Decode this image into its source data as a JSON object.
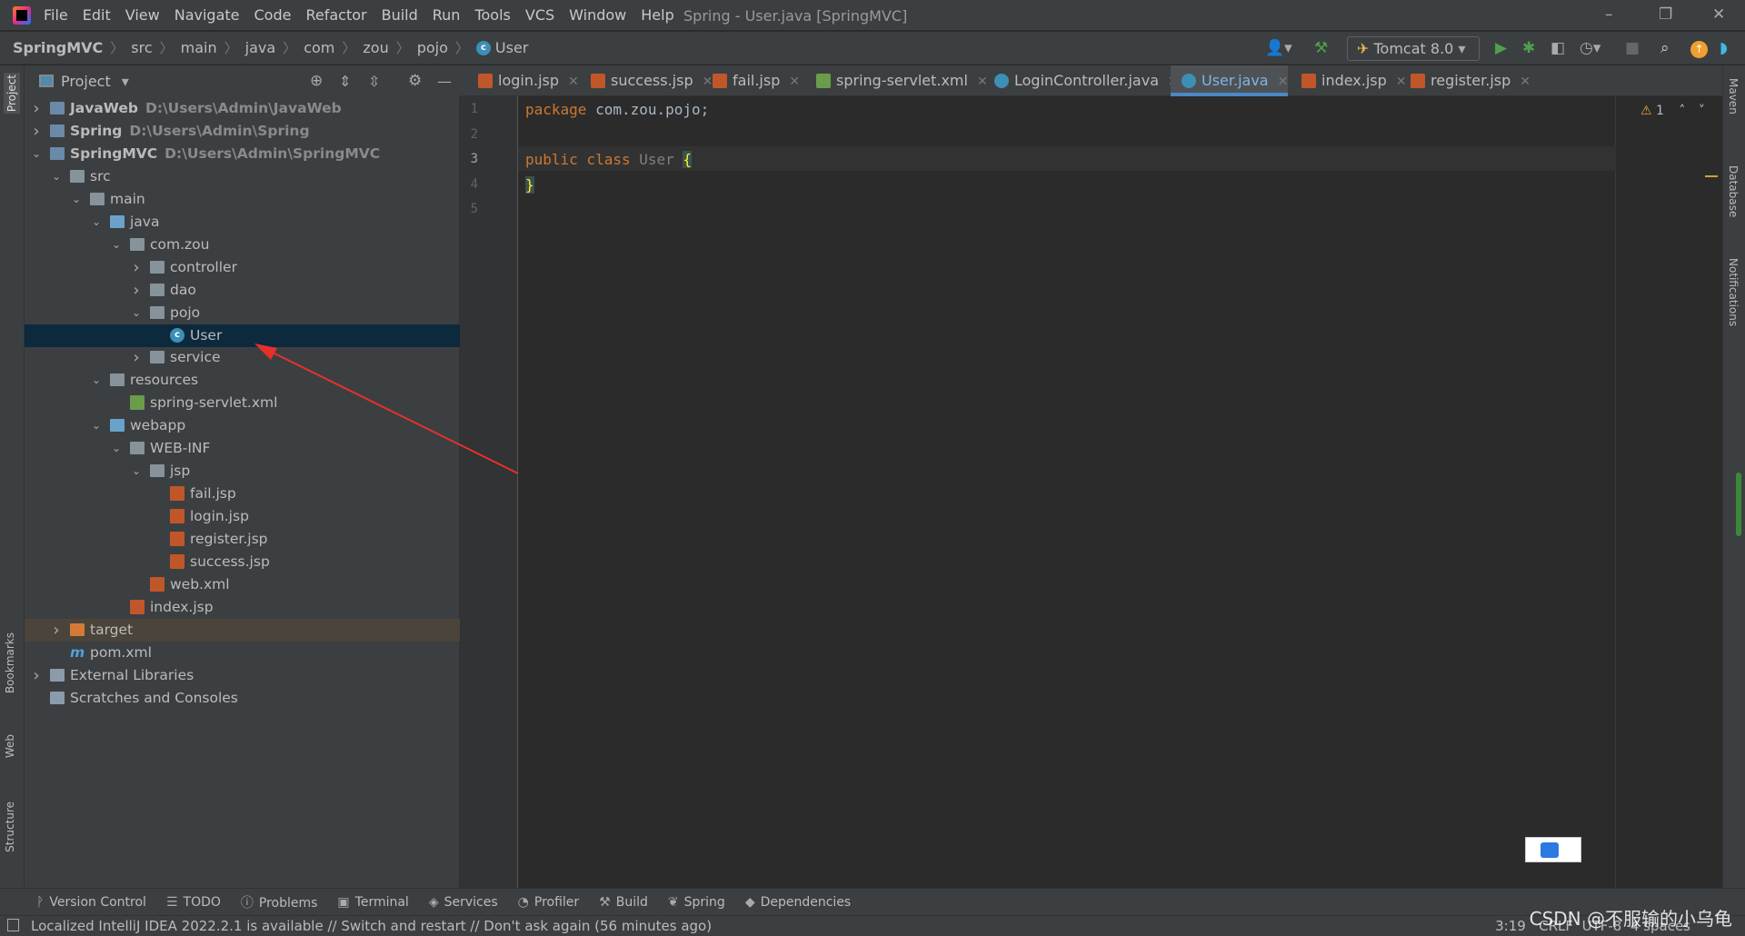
{
  "window": {
    "title": "Spring - User.java [SpringMVC]"
  },
  "menu": [
    "File",
    "Edit",
    "View",
    "Navigate",
    "Code",
    "Refactor",
    "Build",
    "Run",
    "Tools",
    "VCS",
    "Window",
    "Help"
  ],
  "breadcrumb": [
    "SpringMVC",
    "src",
    "main",
    "java",
    "com",
    "zou",
    "pojo",
    "User"
  ],
  "toolbar": {
    "run_config": "Tomcat 8.0"
  },
  "project_panel": {
    "title": "Project"
  },
  "tree": [
    {
      "label": "JavaWeb",
      "path": "D:\\Users\\Admin\\JavaWeb",
      "depth": 0,
      "chev": ">",
      "icon": "mod",
      "bold": true
    },
    {
      "label": "Spring",
      "path": "D:\\Users\\Admin\\Spring",
      "depth": 0,
      "chev": ">",
      "icon": "mod",
      "bold": true
    },
    {
      "label": "SpringMVC",
      "path": "D:\\Users\\Admin\\SpringMVC",
      "depth": 0,
      "chev": "v",
      "icon": "mod",
      "bold": true
    },
    {
      "label": "src",
      "depth": 1,
      "chev": "v",
      "icon": "folder"
    },
    {
      "label": "main",
      "depth": 2,
      "chev": "v",
      "icon": "folder"
    },
    {
      "label": "java",
      "depth": 3,
      "chev": "v",
      "icon": "folder blue"
    },
    {
      "label": "com.zou",
      "depth": 4,
      "chev": "v",
      "icon": "folder"
    },
    {
      "label": "controller",
      "depth": 5,
      "chev": ">",
      "icon": "folder"
    },
    {
      "label": "dao",
      "depth": 5,
      "chev": ">",
      "icon": "folder"
    },
    {
      "label": "pojo",
      "depth": 5,
      "chev": "v",
      "icon": "folder"
    },
    {
      "label": "User",
      "depth": 6,
      "chev": "",
      "icon": "class",
      "selected": true
    },
    {
      "label": "service",
      "depth": 5,
      "chev": ">",
      "icon": "folder"
    },
    {
      "label": "resources",
      "depth": 3,
      "chev": "v",
      "icon": "folder"
    },
    {
      "label": "spring-servlet.xml",
      "depth": 4,
      "chev": "",
      "icon": "xml"
    },
    {
      "label": "webapp",
      "depth": 3,
      "chev": "v",
      "icon": "folder blue"
    },
    {
      "label": "WEB-INF",
      "depth": 4,
      "chev": "v",
      "icon": "folder"
    },
    {
      "label": "jsp",
      "depth": 5,
      "chev": "v",
      "icon": "folder"
    },
    {
      "label": "fail.jsp",
      "depth": 6,
      "chev": "",
      "icon": "jsp"
    },
    {
      "label": "login.jsp",
      "depth": 6,
      "chev": "",
      "icon": "jsp"
    },
    {
      "label": "register.jsp",
      "depth": 6,
      "chev": "",
      "icon": "jsp"
    },
    {
      "label": "success.jsp",
      "depth": 6,
      "chev": "",
      "icon": "jsp"
    },
    {
      "label": "web.xml",
      "depth": 5,
      "chev": "",
      "icon": "jsp"
    },
    {
      "label": "index.jsp",
      "depth": 4,
      "chev": "",
      "icon": "jsp"
    },
    {
      "label": "target",
      "depth": 1,
      "chev": ">",
      "icon": "folder orange",
      "target": true
    },
    {
      "label": "pom.xml",
      "depth": 1,
      "chev": "",
      "icon": "pom"
    },
    {
      "label": "External Libraries",
      "depth": 0,
      "chev": ">",
      "icon": "lib"
    },
    {
      "label": "Scratches and Consoles",
      "depth": 0,
      "chev": "",
      "icon": "lib"
    }
  ],
  "tabs": [
    {
      "label": "login.jsp",
      "icon": "jsp"
    },
    {
      "label": "success.jsp",
      "icon": "jsp"
    },
    {
      "label": "fail.jsp",
      "icon": "jsp"
    },
    {
      "label": "spring-servlet.xml",
      "icon": "xml"
    },
    {
      "label": "LoginController.java",
      "icon": "class"
    },
    {
      "label": "User.java",
      "icon": "class",
      "active": true
    },
    {
      "label": "index.jsp",
      "icon": "jsp"
    },
    {
      "label": "register.jsp",
      "icon": "jsp"
    }
  ],
  "editor": {
    "line_numbers": [
      "1",
      "2",
      "3",
      "4",
      "5"
    ],
    "line1_kw": "package",
    "line1_rest": " com.zou.pojo;",
    "line3_kw": "public class",
    "line3_cls": " User ",
    "brace_open": "{",
    "brace_close": "}",
    "warnings": "1"
  },
  "left_strip": [
    "Project",
    "Bookmarks",
    "Web",
    "Structure"
  ],
  "right_strip": [
    "Maven",
    "Database",
    "Notifications"
  ],
  "bottom_tools": [
    "Version Control",
    "TODO",
    "Problems",
    "Terminal",
    "Services",
    "Profiler",
    "Build",
    "Spring",
    "Dependencies"
  ],
  "status": {
    "message": "Localized IntelliJ IDEA 2022.2.1 is available // Switch and restart // Don't ask again (56 minutes ago)",
    "position": "3:19",
    "line_sep": "CRLF",
    "encoding": "UTF-8",
    "indent": "4 spaces"
  },
  "watermark": "CSDN @不服输的小乌龟",
  "colors": {
    "accent": "#4a88c7",
    "selection": "#0d293e",
    "annotation_arrow": "#e8302a"
  }
}
